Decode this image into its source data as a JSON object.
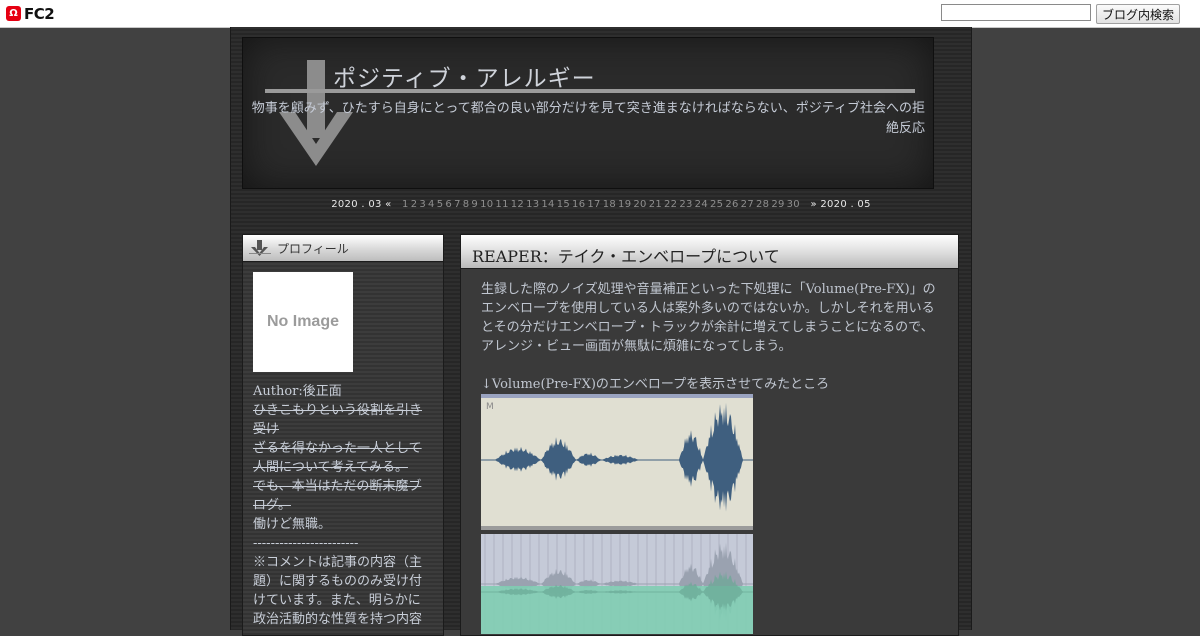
{
  "fc2": {
    "logo_text": "FC2",
    "logo_mark": "Ω",
    "search_value": "",
    "search_button": "ブログ内検索"
  },
  "header": {
    "title": "ポジティブ・アレルギー",
    "description": "物事を顧みず、ひたすら自身にとって都合の良い部分だけを見て突き進まなければならない、ポジティブ社会への拒絶反応"
  },
  "calendar": {
    "prev": "2020 . 03 «",
    "next": "» 2020 . 05",
    "days": [
      "1",
      "2",
      "3",
      "4",
      "5",
      "6",
      "7",
      "8",
      "9",
      "10",
      "11",
      "12",
      "13",
      "14",
      "15",
      "16",
      "17",
      "18",
      "19",
      "20",
      "21",
      "22",
      "23",
      "24",
      "25",
      "26",
      "27",
      "28",
      "29",
      "30"
    ]
  },
  "sidebar": {
    "title": "プロフィール",
    "no_image": "No Image",
    "author": "Author:後正面",
    "strike1": "ひきこもりという役割を引き受け",
    "strike2": "ざるを得なかった一人として人間について考えてみる。",
    "strike3": "でも、本当はただの断末魔ブログ。",
    "line_work": "働けど無職。",
    "divider": "------------------------",
    "note": "※コメントは記事の内容（主題）に関するもののみ受け付けています。また、明らかに政治活動的な性質を持つ内容"
  },
  "article": {
    "title": "REAPER：テイク・エンベロープについて",
    "body": "生録した際のノイズ処理や音量補正といった下処理に「Volume(Pre-FX)」のエンベロープを使用している人は案外多いのではないか。しかしそれを用いるとその分だけエンベロープ・トラックが余計に増えてしまうことになるので、アレンジ・ビュー画面が無駄に煩雑になってしまう。",
    "caption": "↓Volume(Pre-FX)のエンベロープを表示させてみたところ",
    "track_marker": "M"
  },
  "colors": {
    "waveform": "#3f5f7f",
    "envelope_fill": "#7fcdb3",
    "track_bg": "#e0dfd2"
  }
}
